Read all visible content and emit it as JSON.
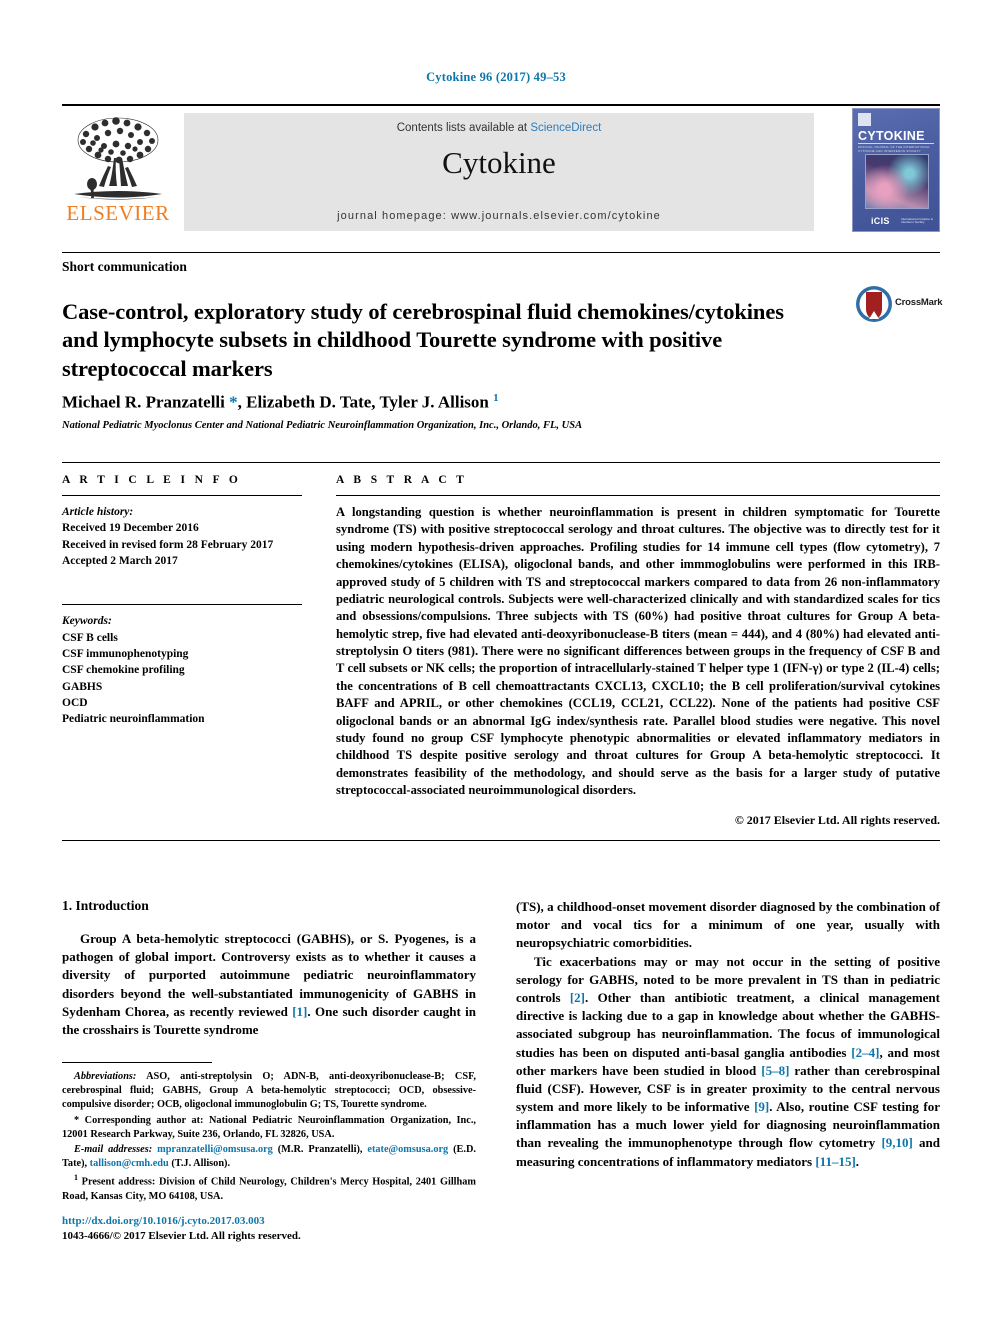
{
  "running_head": "Cytokine 96 (2017) 49–53",
  "masthead": {
    "publisher_name": "ELSEVIER",
    "contents_prefix": "Contents lists available at ",
    "contents_link": "ScienceDirect",
    "journal_name": "Cytokine",
    "homepage": "journal homepage: www.journals.elsevier.com/cytokine",
    "cover": {
      "title": "CYTOKINE",
      "subline": "OFFICIAL JOURNAL OF THE INTERNATIONAL CYTOKINE AND INTERFERON SOCIETY",
      "imprint": "iCIS",
      "imprint_sub": "International Cytokine & Interferon Society"
    },
    "colors": {
      "link_blue": "#2b7dbd",
      "elsevier_orange": "#ef7d22",
      "band_gray": "#e4e4e4",
      "cover_blue": "#4a5da0"
    }
  },
  "article": {
    "doctype": "Short communication",
    "title": "Case-control, exploratory study of cerebrospinal fluid chemokines/cytokines and lymphocyte subsets in childhood Tourette syndrome with positive streptococcal markers",
    "crossmark_label": "CrossMark",
    "authors_html": "Michael R. Pranzatelli <span class=\"star\">*</span>, Elizabeth D. Tate, Tyler J. Allison <span class=\"sup\">1</span>",
    "affiliation": "National Pediatric Myoclonus Center and National Pediatric Neuroinflammation Organization, Inc., Orlando, FL, USA"
  },
  "article_info": {
    "heading": "A R T I C L E   I N F O",
    "history_label": "Article history:",
    "history": [
      "Received 19 December 2016",
      "Received in revised form 28 February 2017",
      "Accepted 2 March 2017"
    ],
    "keywords_label": "Keywords:",
    "keywords": [
      "CSF B cells",
      "CSF immunophenotyping",
      "CSF chemokine profiling",
      "GABHS",
      "OCD",
      "Pediatric neuroinflammation"
    ]
  },
  "abstract": {
    "heading": "A B S T R A C T",
    "text": "A longstanding question is whether neuroinflammation is present in children symptomatic for Tourette syndrome (TS) with positive streptococcal serology and throat cultures. The objective was to directly test for it using modern hypothesis-driven approaches. Profiling studies for 14 immune cell types (flow cytometry), 7 chemokines/cytokines (ELISA), oligoclonal bands, and other immmoglobulins were performed in this IRB-approved study of 5 children with TS and streptococcal markers compared to data from 26 non-inflammatory pediatric neurological controls. Subjects were well-characterized clinically and with standardized scales for tics and obsessions/compulsions. Three subjects with TS (60%) had positive throat cultures for Group A beta-hemolytic strep, five had elevated anti-deoxyribonuclease-B titers (mean = 444), and 4 (80%) had elevated anti-streptolysin O titers (981). There were no significant differences between groups in the frequency of CSF B and T cell subsets or NK cells; the proportion of intracellularly-stained T helper type 1 (IFN-γ) or type 2 (IL-4) cells; the concentrations of B cell chemoattractants CXCL13, CXCL10; the B cell proliferation/survival cytokines BAFF and APRIL, or other chemokines (CCL19, CCL21, CCL22). None of the patients had positive CSF oligoclonal bands or an abnormal IgG index/synthesis rate. Parallel blood studies were negative. This novel study found no group CSF lymphocyte phenotypic abnormalities or elevated inflammatory mediators in childhood TS despite positive serology and throat cultures for Group A beta-hemolytic streptococci. It demonstrates feasibility of the methodology, and should serve as the basis for a larger study of putative streptococcal-associated neuroimmunological disorders.",
    "copyright": "© 2017 Elsevier Ltd. All rights reserved."
  },
  "body": {
    "intro_heading": "1. Introduction",
    "left_paragraph_html": "Group A beta-hemolytic streptococci (GABHS), or S. Pyogenes, is a pathogen of global import. Controversy exists as to whether it causes a diversity of purported autoimmune pediatric neuroinflammatory disorders beyond the well-substantiated immunogenicity of GABHS in Sydenham Chorea, as recently reviewed <span class=\"ref\">[1]</span>. One such disorder caught in the crosshairs is Tourette syndrome",
    "right_paragraph1_html": "(TS), a childhood-onset movement disorder diagnosed by the combination of motor and vocal tics for a minimum of one year, usually with neuropsychiatric comorbidities.",
    "right_paragraph2_html": "Tic exacerbations may or may not occur in the setting of positive serology for GABHS, noted to be more prevalent in TS than in pediatric controls <span class=\"ref\">[2]</span>. Other than antibiotic treatment, a clinical management directive is lacking due to a gap in knowledge about whether the GABHS-associated subgroup has neuroinflammation. The focus of immunological studies has been on disputed anti-basal ganglia antibodies <span class=\"ref\">[2–4]</span>, and most other markers have been studied in blood <span class=\"ref\">[5–8]</span> rather than cerebrospinal fluid (CSF). However, CSF is in greater proximity to the central nervous system and more likely to be informative <span class=\"ref\">[9]</span>. Also, routine CSF testing for inflammation has a much lower yield for diagnosing neuroinflammation than revealing the immunophenotype through flow cytometry <span class=\"ref\">[9,10]</span> and measuring concentrations of inflammatory mediators <span class=\"ref\">[11–15]</span>."
  },
  "footnotes": {
    "abbreviations_html": "<span class=\"ital\">Abbreviations:</span> ASO, anti-streptolysin O; ADN-B, anti-deoxyribonuclease-B; CSF, cerebrospinal fluid; GABHS, Group A beta-hemolytic streptococci; OCD, obsessive-compulsive disorder; OCB, oligoclonal immunoglobulin G; TS, Tourette syndrome.",
    "corresponding_html": "* Corresponding author at: National Pediatric Neuroinflammation Organization, Inc., 12001 Research Parkway, Suite 236, Orlando, FL 32826, USA.",
    "emails_html": "<span class=\"ital\">E-mail addresses:</span> <span class=\"link\">mpranzatelli@omsusa.org</span> (M.R. Pranzatelli), <span class=\"link\">etate@omsusa.org</span> (E.D. Tate), <span class=\"link\">tallison@cmh.edu</span> (T.J. Allison).",
    "present_address_html": "<span class=\"sup\">1</span> Present address: Division of Child Neurology, Children's Mercy Hospital, 2401 Gillham Road, Kansas City, MO 64108, USA."
  },
  "footer": {
    "doi": "http://dx.doi.org/10.1016/j.cyto.2017.03.003",
    "issn_copyright": "1043-4666/© 2017 Elsevier Ltd. All rights reserved."
  }
}
